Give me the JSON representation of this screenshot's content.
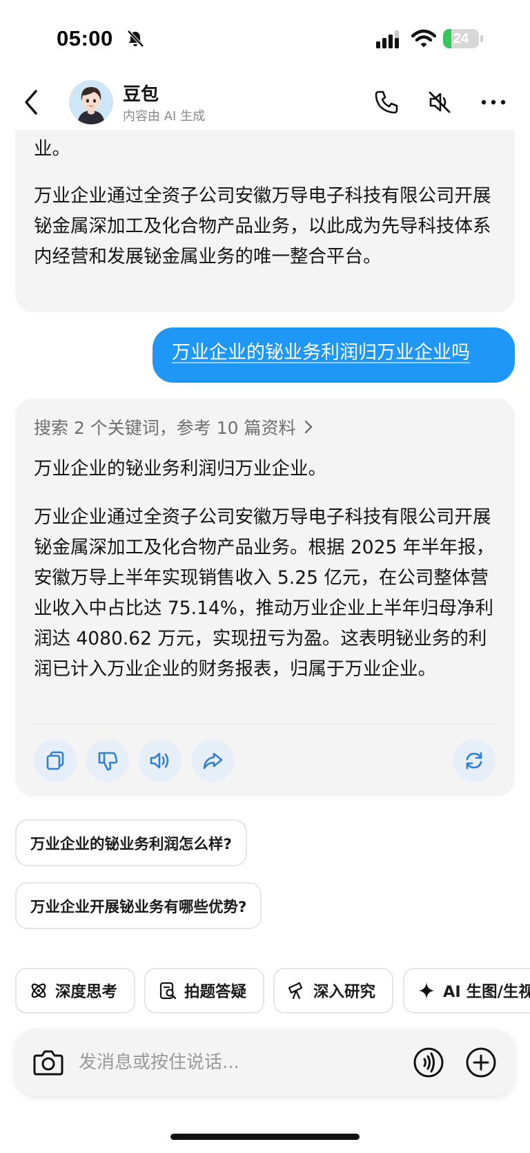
{
  "status_bar": {
    "time": "05:00",
    "battery_level": "24",
    "battery_fraction": 0.24,
    "battery_color": "#35c759",
    "icons": [
      "bell-slash-icon",
      "cellular-signal-icon",
      "wifi-icon",
      "battery-icon"
    ]
  },
  "header": {
    "name": "豆包",
    "subtitle": "内容由 AI 生成",
    "icons": [
      "back-icon",
      "avatar",
      "phone-icon",
      "speaker-mute-icon",
      "more-icon"
    ]
  },
  "chat": {
    "bubble_1": {
      "tail_text": "业。",
      "paragraph": "万业企业通过全资子公司安徽万导电子科技有限公司开展铋金属深加工及化合物产品业务，以此成为先导科技体系内经营和发展铋金属业务的唯一整合平台。"
    },
    "user_message": "万业企业的铋业务利润归万业企业吗",
    "answer": {
      "search_summary": "搜索 2 个关键词，参考 10 篇资料",
      "paragraph_1": "万业企业的铋业务利润归万业企业。",
      "paragraph_2": "万业企业通过全资子公司安徽万导电子科技有限公司开展铋金属深加工及化合物产品业务。根据 2025 年半年报，安徽万导上半年实现销售收入 5.25 亿元，在公司整体营业收入中占比达 75.14%，推动万业企业上半年归母净利润达 4080.62 万元，实现扭亏为盈。这表明铋业务的利润已计入万业企业的财务报表，归属于万业企业。",
      "actions": [
        "copy-icon",
        "dislike-icon",
        "read-aloud-icon",
        "share-icon",
        "regenerate-icon"
      ]
    },
    "suggestions": [
      "万业企业的铋业务利润怎么样?",
      "万业企业开展铋业务有哪些优势?"
    ]
  },
  "chips": [
    {
      "label": "深度思考",
      "icon": "atom-icon"
    },
    {
      "label": "拍题答疑",
      "icon": "photo-question-icon"
    },
    {
      "label": "深入研究",
      "icon": "telescope-icon"
    },
    {
      "label": "AI 生图/生视",
      "icon": "sparkle-icon"
    }
  ],
  "input": {
    "placeholder": "发消息或按住说话..."
  },
  "colors": {
    "accent": "#1e97f7",
    "bubble_bg": "#f4f4f5",
    "action_bg": "#e6eef8",
    "action_icon": "#2f7fd4"
  }
}
